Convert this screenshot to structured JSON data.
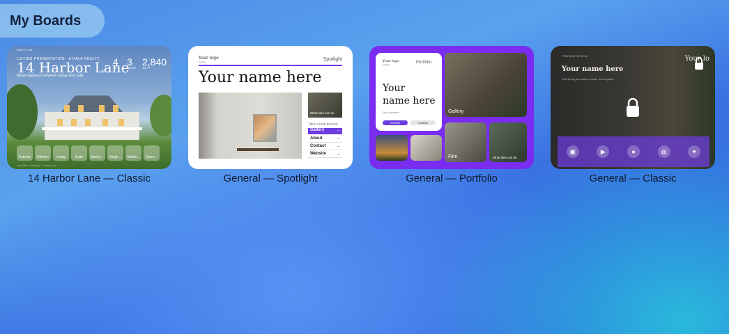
{
  "header": {
    "title": "My Boards"
  },
  "boards": [
    {
      "caption": "14 Harbor Lane — Classic",
      "ribbon": "Room 3, 201",
      "kicker": "LISTING PRESENTATION · A HALE REALTY",
      "title": "14 Harbor Lane",
      "subtitle": "What happens between today and sold.",
      "stats": [
        {
          "value": "4",
          "label": "BD"
        },
        {
          "value": "3",
          "label": "BATHS"
        },
        {
          "value": "2,840",
          "label": "SQ FT"
        }
      ],
      "chips": [
        "Exterior",
        "Kitchen",
        "Living",
        "Suite",
        "Backy...",
        "Neigh...",
        "Marke...",
        "Open..."
      ],
      "footer": "Listed 2025 · Hale Realty · 14 Harbor Lane"
    },
    {
      "caption": "General — Spotlight",
      "logo": "Your logo",
      "logo_sub": "tagline",
      "brand": "Spotlight",
      "name": "Your name here",
      "thumb_label": "What tiles can do",
      "look_around": "Take a look around.",
      "links": [
        "Gallery",
        "About",
        "Contact",
        "Website"
      ],
      "arrow": "→"
    },
    {
      "caption": "General — Portfolio",
      "logo": "Your logo",
      "logo_sub": "tagline",
      "brand": "Portfolio",
      "name_line1": "Your",
      "name_line2": "name here",
      "start": "Start anywhere",
      "pill1": "Website",
      "pill2": "Contact",
      "tile_gallery": "Gallery",
      "tile_film": "Film",
      "tile_what": "What tiles can do"
    },
    {
      "caption": "General — Classic",
      "kicker": "PRESENTATION",
      "brand": "Your lo",
      "name": "Your name here",
      "subtitle": "Everything you want to show, in one place.",
      "dock_icons": [
        "image-icon",
        "video-icon",
        "person-icon",
        "globe-icon",
        "sparkle-icon"
      ]
    }
  ]
}
